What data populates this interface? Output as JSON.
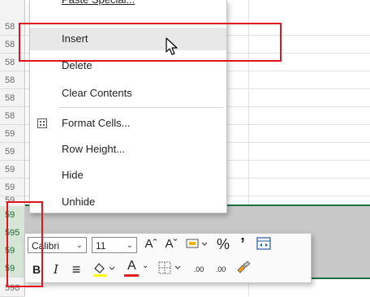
{
  "row_headers": [
    {
      "label": "58",
      "selected": false
    },
    {
      "label": "58",
      "selected": false
    },
    {
      "label": "58",
      "selected": false
    },
    {
      "label": "58",
      "selected": false
    },
    {
      "label": "58",
      "selected": false
    },
    {
      "label": "58",
      "selected": false
    },
    {
      "label": "59",
      "selected": false
    },
    {
      "label": "59",
      "selected": false
    },
    {
      "label": "59",
      "selected": false
    },
    {
      "label": "59",
      "selected": false
    },
    {
      "label": "59",
      "selected": false
    },
    {
      "label": "59",
      "selected": true
    },
    {
      "label": "595",
      "selected": true
    },
    {
      "label": "59",
      "selected": true
    },
    {
      "label": "59",
      "selected": true
    },
    {
      "label": "598",
      "selected": false
    }
  ],
  "context_menu": {
    "items": [
      {
        "label": "Paste Special...",
        "partial": true
      },
      {
        "label": "Insert",
        "hover": true
      },
      {
        "label": "Delete"
      },
      {
        "label": "Clear Contents"
      },
      {
        "label": "Format Cells...",
        "icon": "format-cells-icon"
      },
      {
        "label": "Row Height..."
      },
      {
        "label": "Hide"
      },
      {
        "label": "Unhide"
      }
    ]
  },
  "mini_toolbar": {
    "font_name": "Calibri",
    "font_size": "11",
    "increase_font_glyph": "Aˆ",
    "decrease_font_glyph": "Aˇ",
    "percent_glyph": "%",
    "comma_glyph": "’",
    "bold_glyph": "B",
    "italic_glyph": "I",
    "align_glyph": "≡",
    "font_color_glyph": "A",
    "increase_decimal_glyph": ".00",
    "decrease_decimal_glyph": ".00",
    "fill_color": "#ffff00",
    "font_color": "#e01e1e"
  },
  "colors": {
    "selection_green": "#1e7145",
    "highlight_red": "#e0141e"
  }
}
